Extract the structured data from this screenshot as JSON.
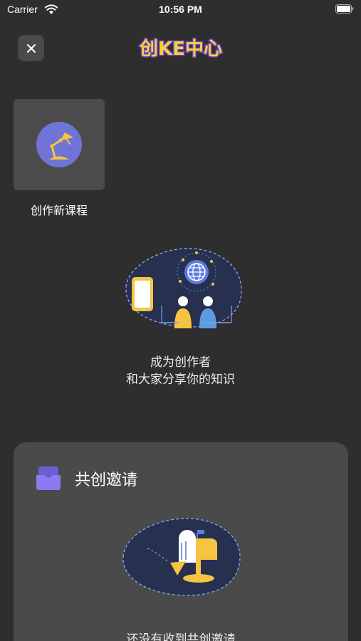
{
  "status_bar": {
    "carrier": "Carrier",
    "time": "10:56 PM"
  },
  "header": {
    "close_icon": "close-icon",
    "logo_text": "创KE中心"
  },
  "create_course": {
    "icon": "desk-lamp-icon",
    "label": "创作新课程"
  },
  "creator_promo": {
    "illustration": "creators-globe-illustration",
    "line1": "成为创作者",
    "line2": "和大家分享你的知识"
  },
  "invitations": {
    "icon": "inbox-icon",
    "title": "共创邀请",
    "illustration": "mailbox-illustration",
    "empty_text": "还没有收到共创邀请"
  },
  "colors": {
    "background": "#2e2e2e",
    "card": "#4a4a4a",
    "accent_purple": "#7b6ee0",
    "accent_yellow": "#f5c542",
    "illustration_bg": "#27304f"
  }
}
